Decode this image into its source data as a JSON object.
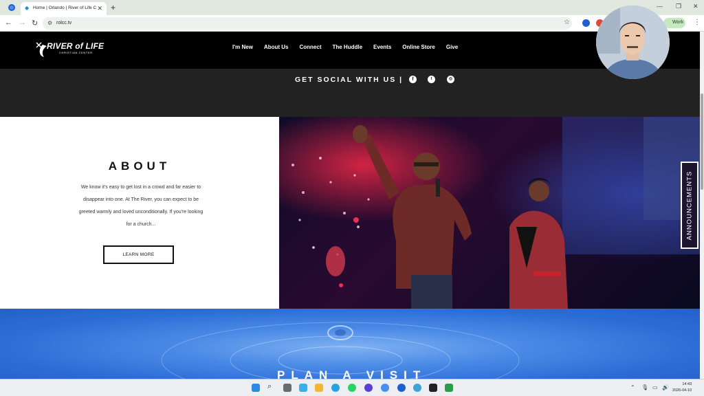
{
  "browser": {
    "tab_title": "Home | Orlando | River of Life C",
    "new_tab": "+",
    "url": "rolcc.tv",
    "profile_label": "Work",
    "window_controls": [
      "—",
      "❐",
      "✕"
    ]
  },
  "site": {
    "logo_text": "RIVER of LIFE",
    "logo_sub": "CHRISTIAN CENTER",
    "nav": [
      "I'm New",
      "About Us",
      "Connect",
      "The Huddle",
      "Events",
      "Online Store",
      "Give"
    ]
  },
  "social": {
    "label": "GET SOCIAL WITH US |",
    "icons": [
      "facebook-icon",
      "twitter-icon",
      "instagram-icon"
    ]
  },
  "about": {
    "title": "ABOUT",
    "body": "We know it's easy to get lost in a crowd and far easier to disappear into one. At The River, you can expect to be greeted warmly and loved unconditionally. If you're looking for a church...",
    "button": "LEARN MORE"
  },
  "announcements": {
    "label": "ANNOUNCEMENTS"
  },
  "plan": {
    "title": "PLAN A VISIT"
  },
  "taskbar": {
    "time": "14:43",
    "date": "2026-04-10"
  },
  "colors": {
    "header_bg": "#000000",
    "social_bg": "#222222",
    "plan_bg": "#3b7ddf",
    "chrome_tabbar": "#dfe7df"
  }
}
